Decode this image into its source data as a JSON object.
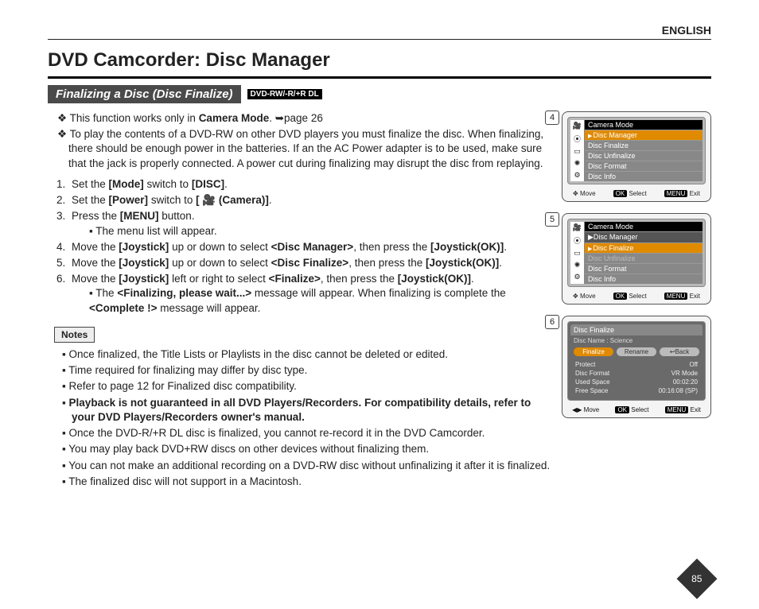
{
  "lang": "ENGLISH",
  "title": "DVD Camcorder: Disc Manager",
  "subtitle": "Finalizing a Disc (Disc Finalize)",
  "disc_tag": "DVD-RW/-R/+R DL",
  "hearts": [
    "This function works only in Camera Mode. ➥page 26",
    "To play the contents of a DVD-RW on other DVD players you must finalize the disc. When finalizing, there should be enough power in the batteries. If an the AC Power adapter is to be used, make sure that the jack is properly connected. A power cut during finalizing may disrupt the disc from replaying."
  ],
  "steps": [
    "Set the [Mode] switch to [DISC].",
    "Set the [Power] switch to [ 🎥 (Camera)].",
    "Press the [MENU] button.",
    "Move the [Joystick] up or down to select <Disc Manager>, then press the [Joystick(OK)].",
    "Move the [Joystick] up or down to select <Disc Finalize>, then press the [Joystick(OK)].",
    "Move the [Joystick] left or right to select <Finalize>, then press the [Joystick(OK)]."
  ],
  "step3_sub": "The menu list will appear.",
  "step6_sub": "The <Finalizing, please wait...> message will appear. When finalizing is complete the <Complete !> message will appear.",
  "notes_label": "Notes",
  "notes": [
    "Once finalized, the Title Lists or Playlists in the disc cannot be deleted or edited.",
    "Time required for finalizing may differ by disc type.",
    "Refer to page 12 for Finalized disc compatibility.",
    "Playback is not guaranteed in all DVD Players/Recorders. For compatibility details, refer to your DVD Players/Recorders owner's manual.",
    "Once the DVD-R/+R DL disc is finalized, you cannot re-record it in the DVD Camcorder.",
    "You may play back DVD+RW discs on other devices without finalizing them.",
    "You can not make an additional recording on a DVD-RW disc without unfinalizing it after it is finalized.",
    "The finalized disc will not support in a Macintosh."
  ],
  "note_bold_idx": 3,
  "panel4": {
    "num": "4",
    "title": "Camera Mode",
    "items": [
      "Disc Manager",
      "Disc Finalize",
      "Disc Unfinalize",
      "Disc Format",
      "Disc Info"
    ],
    "sel": 0,
    "foot": {
      "move": "Move",
      "select": "Select",
      "exit": "Exit"
    }
  },
  "panel5": {
    "num": "5",
    "title": "Camera Mode",
    "items": [
      "Disc Manager",
      "Disc Finalize",
      "Disc Unfinalize",
      "Disc Format",
      "Disc Info"
    ],
    "sel": 1,
    "dim": [
      2
    ],
    "foot": {
      "move": "Move",
      "select": "Select",
      "exit": "Exit"
    }
  },
  "panel6": {
    "num": "6",
    "hdr": "Disc Finalize",
    "discname": "Disc Name : Science",
    "btns": [
      "Finalize",
      "Rename",
      "↩Back"
    ],
    "btn_sel": 0,
    "info": [
      [
        "Protect",
        "Off"
      ],
      [
        "Disc Format",
        "VR Mode"
      ],
      [
        "Used Space",
        "00:02:20"
      ],
      [
        "Free Space",
        "00:16:08 (SP)"
      ]
    ],
    "foot": {
      "move": "Move",
      "select": "Select",
      "exit": "Exit"
    }
  },
  "foot_btns": {
    "arrows": "✥",
    "ok": "OK",
    "menu": "MENU",
    "lr": "◀▶"
  },
  "page_num": "85"
}
